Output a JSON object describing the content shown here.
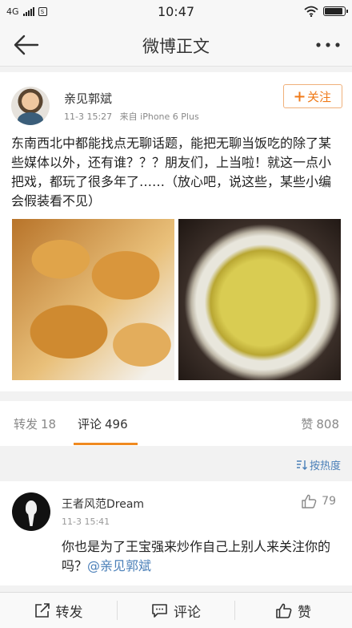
{
  "status_bar": {
    "network": "4G",
    "time": "10:47"
  },
  "nav": {
    "title": "微博正文",
    "back_icon": "arrow-left-icon",
    "more_icon": "ellipsis-icon"
  },
  "post": {
    "author": "亲见郭斌",
    "date": "11-3 15:27",
    "source": "来自 iPhone 6 Plus",
    "follow_label": "关注",
    "text": "东南西北中都能找点无聊话题，能把无聊当饭吃的除了某些媒体以外，还有谁？？？朋友们，上当啦！就这一点小把戏，都玩了很多年了……（放心吧，说这些，某些小编会假装看不见）"
  },
  "tabs": {
    "repost_label": "转发",
    "repost_count": "18",
    "comment_label": "评论",
    "comment_count": "496",
    "like_label": "赞",
    "like_count": "808"
  },
  "sort": {
    "label": "按热度"
  },
  "comment": {
    "author": "王者风范Dream",
    "time": "11-3 15:41",
    "likes": "79",
    "text": "你也是为了王宝强来炒作自己上别人来关注你的吗？",
    "mention": "@亲见郭斌"
  },
  "bottom_bar": {
    "repost_label": "转发",
    "comment_label": "评论",
    "like_label": "赞"
  },
  "colors": {
    "accent_orange": "#f07a18",
    "link_blue": "#4a7fb8"
  }
}
